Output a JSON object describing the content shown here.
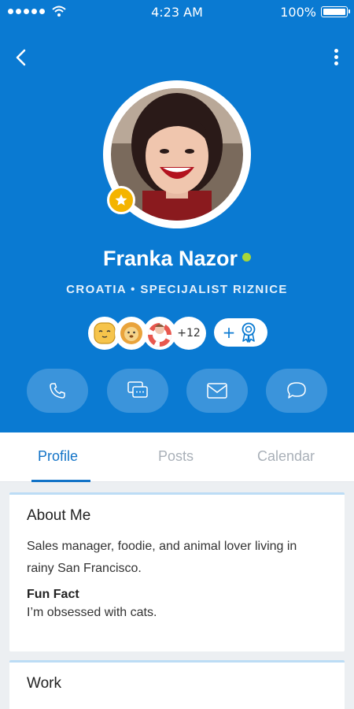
{
  "status_bar": {
    "time": "4:23 AM",
    "battery": "100%"
  },
  "profile": {
    "name": "Franka Nazor",
    "subtitle": "CROATIA • SPECIJALIST RIZNICE",
    "badges_more": "+12",
    "add_badge": "+"
  },
  "actions": [
    "phone-icon",
    "chat-icon",
    "mail-icon",
    "message-icon"
  ],
  "tabs": [
    {
      "label": "Profile",
      "active": true
    },
    {
      "label": "Posts",
      "active": false
    },
    {
      "label": "Calendar",
      "active": false
    }
  ],
  "about": {
    "title": "About Me",
    "text": "Sales manager, foodie, and animal lover living in rainy San Francisco.",
    "fun_fact_title": "Fun Fact",
    "fun_fact_text": "I’m obsessed with cats."
  },
  "work": {
    "title": "Work"
  },
  "colors": {
    "header": "#0a7ad2",
    "accent": "#1273c7",
    "online": "#a7d63a",
    "star": "#f4b400"
  }
}
